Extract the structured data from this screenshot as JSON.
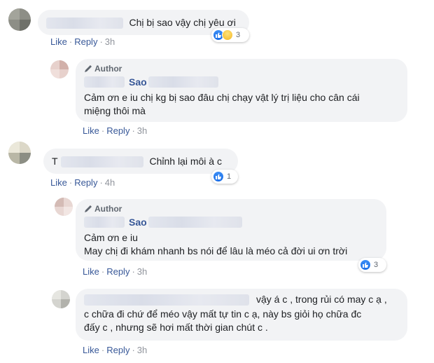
{
  "actions": {
    "like": "Like",
    "reply": "Reply"
  },
  "author_tag": "Author",
  "comments": [
    {
      "text": "Chị bị sao vậy chị yêu ơi",
      "time": "3h",
      "reactions": "3"
    },
    {
      "name_visible": "Sao",
      "text": "Cảm ơn e iu chị kg bị sao đâu chị chạy vật lý trị liệu cho cân cái miệng thôi mà",
      "line1": "Cảm ơn e iu chị kg bị sao đâu chị chạy vật lý trị liệu cho cân cái",
      "line2": "miệng thôi mà",
      "time": "3h"
    },
    {
      "name_visible": "T",
      "text": "Chỉnh lại môi à c",
      "time": "4h",
      "reactions": "1"
    },
    {
      "name_visible": "Sao",
      "line1": "Cảm ơn e iu",
      "line2": "May chị đi khám nhanh bs nói để lâu là méo cả đời ui ơn trời",
      "time": "3h",
      "reactions": "3"
    },
    {
      "line1": "vậy á c , trong rủi có may c ạ ,",
      "line2": "c chữa đi chứ để méo vậy mất tự tin c ạ, này bs giỏi họ chữa đc",
      "line3": "đấy c , nhưng sẽ hơi mất thời gian chút c .",
      "time": "3h"
    }
  ],
  "icons": [
    "like-icon",
    "haha-icon",
    "pencil-icon"
  ],
  "colors": {
    "link": "#385898",
    "bubble": "#f2f3f5",
    "meta": "#90949c",
    "like": "#1877f2"
  }
}
